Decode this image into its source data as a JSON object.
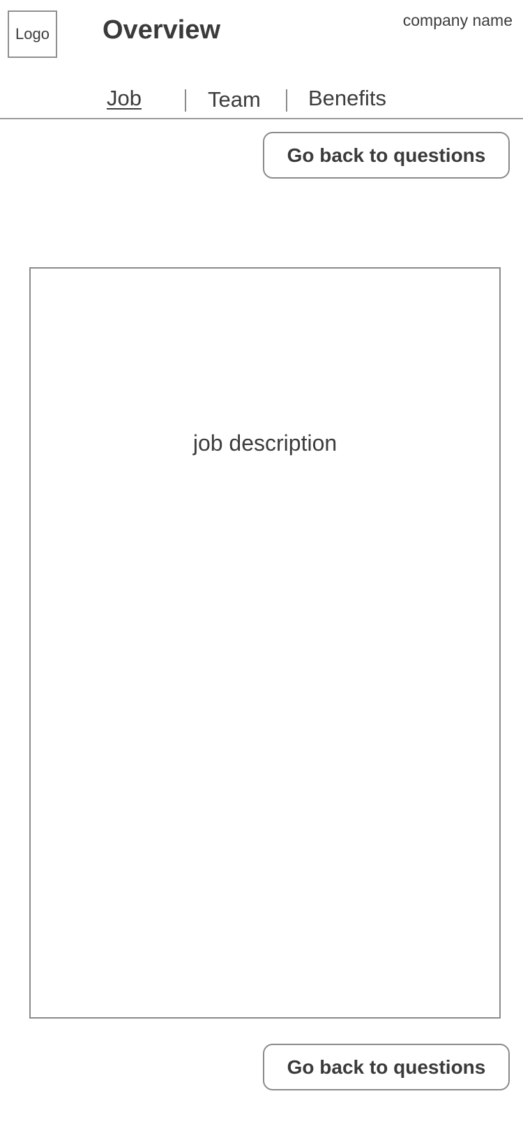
{
  "header": {
    "logo_label": "Logo",
    "title": "Overview",
    "company_name": "company name"
  },
  "tabs": [
    {
      "label": "Job",
      "active": true
    },
    {
      "label": "Team",
      "active": false
    },
    {
      "label": "Benefits",
      "active": false
    }
  ],
  "actions": {
    "back_top_label": "Go back to questions",
    "back_bottom_label": "Go back to questions"
  },
  "main": {
    "job_description_placeholder": "job description"
  },
  "colors": {
    "border": "#8a8a8a",
    "text": "#3c3c3c",
    "background": "#ffffff"
  }
}
